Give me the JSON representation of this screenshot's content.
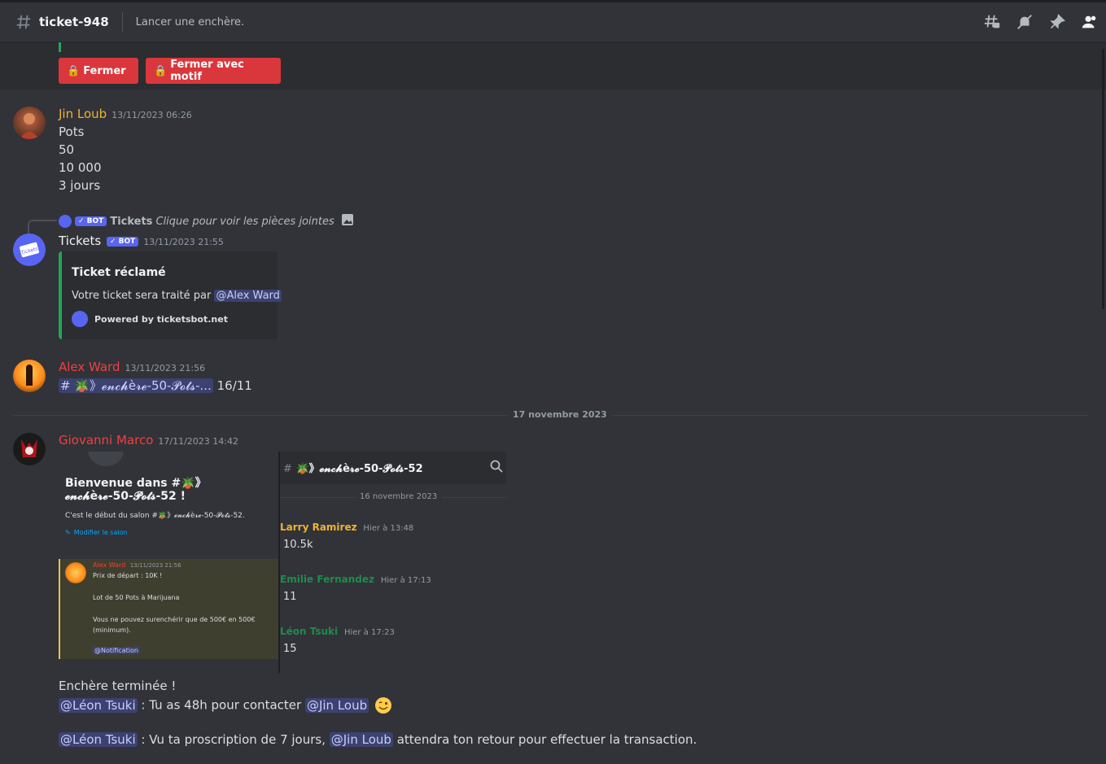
{
  "header": {
    "channel_name": "ticket-948",
    "topic": "Lancer une enchère.",
    "icons": [
      "threads-icon",
      "mute-notifications-icon",
      "pin-icon",
      "members-icon"
    ]
  },
  "top_buttons": {
    "close": "Fermer",
    "close_reason": "Fermer avec motif"
  },
  "messages": {
    "m1": {
      "author": "Jin Loub",
      "author_color": "#f0b232",
      "timestamp": "13/11/2023 06:26",
      "lines": [
        "Pots",
        "50",
        "10 000",
        "3 jours"
      ]
    },
    "m2": {
      "reply_author": "Tickets",
      "reply_bot": "✓ BOT",
      "reply_text": "Clique pour voir les pièces jointes",
      "author": "Tickets",
      "bot_tag": "✓ BOT",
      "timestamp": "13/11/2023 21:55",
      "embed": {
        "title": "Ticket réclamé",
        "desc_prefix": "Votre ticket sera traité par",
        "mention": "@Alex Ward",
        "footer": "Powered by ticketsbot.net",
        "accent": "#23a55a"
      }
    },
    "m3": {
      "author": "Alex Ward",
      "author_color": "#f23f43",
      "timestamp": "13/11/2023 21:56",
      "channel_link": "# 🪴》𝓮𝓷𝓬𝓱è𝓻𝓮-50-𝓟𝓸𝓽𝓼-...",
      "suffix": "16/11"
    },
    "divider": "17 novembre 2023",
    "m4": {
      "author": "Giovanni Marco",
      "author_color": "#f23f43",
      "timestamp": "17/11/2023 14:42",
      "image": {
        "welcome_title": "Bienvenue dans #🪴》",
        "welcome_title2": "𝓮𝓷𝓬𝓱è𝓻𝓮-50-𝓟𝓸𝓽𝓼-52 !",
        "welcome_sub": "C'est le début du salon #🪴》𝓮𝓷𝓬𝓱è𝓻𝓮-50-𝓟𝓸𝓽𝓼-52.",
        "edit_link": "Modifier le salon",
        "inner_author": "Alex Ward",
        "inner_ts": "13/11/2023 21:56",
        "inner_lines": [
          "Prix de départ : 10K !",
          "Lot de 50 Pots à Marijuana",
          "Vous ne pouvez surenchérir que de 500€ en 500€",
          "(minimum)."
        ],
        "inner_mention": "@Notification",
        "right_channel": "🪴》𝓮𝓷𝓬𝓱è𝓻𝓮-50-𝓟𝓸𝓽𝓼-52",
        "right_date": "16 novembre 2023",
        "bids": [
          {
            "author": "Larry Ramirez",
            "color": "#f0b232",
            "ts": "Hier à 13:48",
            "value": "10.5k"
          },
          {
            "author": "Emilie Fernandez",
            "color": "#1f8b4c",
            "ts": "Hier à 17:13",
            "value": "11"
          },
          {
            "author": "Léon Tsuki",
            "color": "#1f8b4c",
            "ts": "Hier à 17:23",
            "value": "15"
          }
        ]
      },
      "text1": "Enchère terminée !",
      "mention_leon": "@Léon Tsuki",
      "text2": " : Tu as 48h pour contacter ",
      "mention_jin": "@Jin Loub",
      "text3": " : Vu ta proscription de 7 jours, ",
      "text4": " attendra ton retour pour effectuer la transaction."
    }
  }
}
